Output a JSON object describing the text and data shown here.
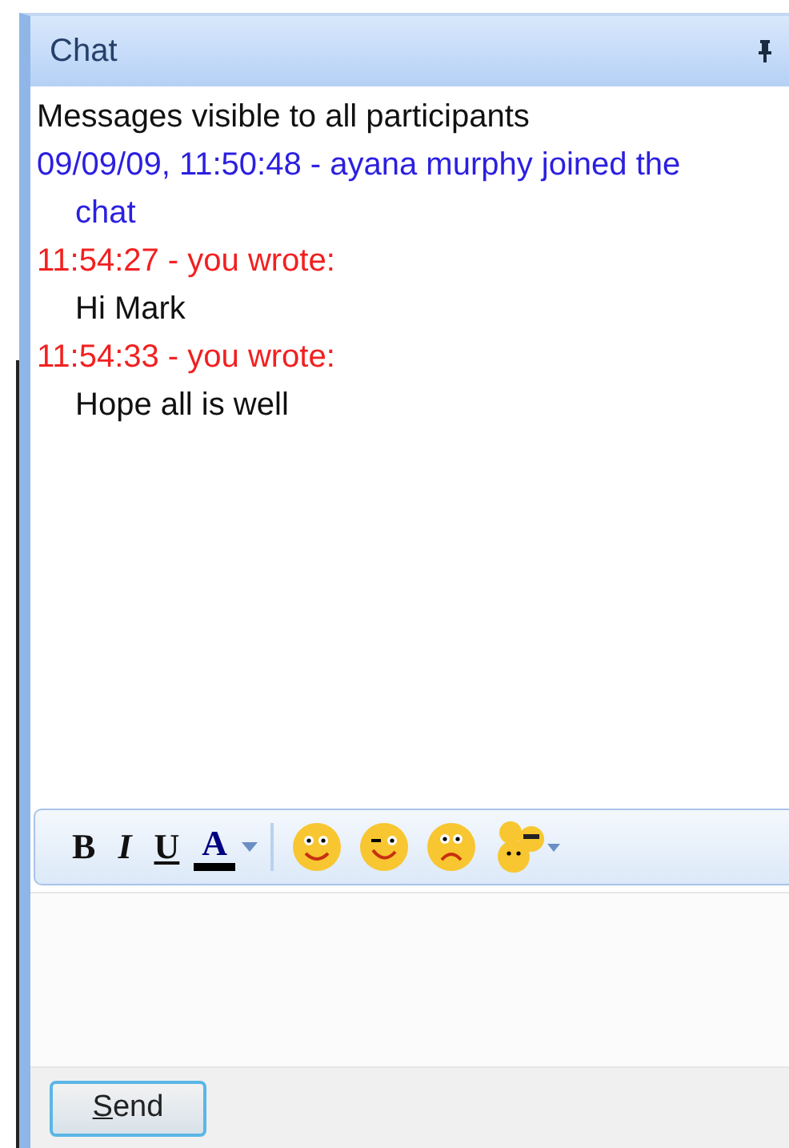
{
  "panel": {
    "title": "Chat"
  },
  "messages": [
    {
      "kind": "notice",
      "text": "Messages visible to all participants"
    },
    {
      "kind": "event",
      "text": "09/09/09, 11:50:48 - ayana murphy joined the chat"
    },
    {
      "kind": "author",
      "text": "11:54:27 - you wrote:"
    },
    {
      "kind": "body",
      "text": "Hi Mark"
    },
    {
      "kind": "author",
      "text": "11:54:33 - you wrote:"
    },
    {
      "kind": "body",
      "text": "Hope all is well"
    }
  ],
  "toolbar": {
    "format_buttons": [
      {
        "kind": "bold",
        "label": "B"
      },
      {
        "kind": "italic",
        "label": "I"
      },
      {
        "kind": "underline",
        "label": "U"
      },
      {
        "kind": "color",
        "label": "A"
      }
    ],
    "emoticons": [
      {
        "kind": "smile"
      },
      {
        "kind": "wink"
      },
      {
        "kind": "sad"
      },
      {
        "kind": "more"
      }
    ]
  },
  "send_button": {
    "label": "Send"
  }
}
